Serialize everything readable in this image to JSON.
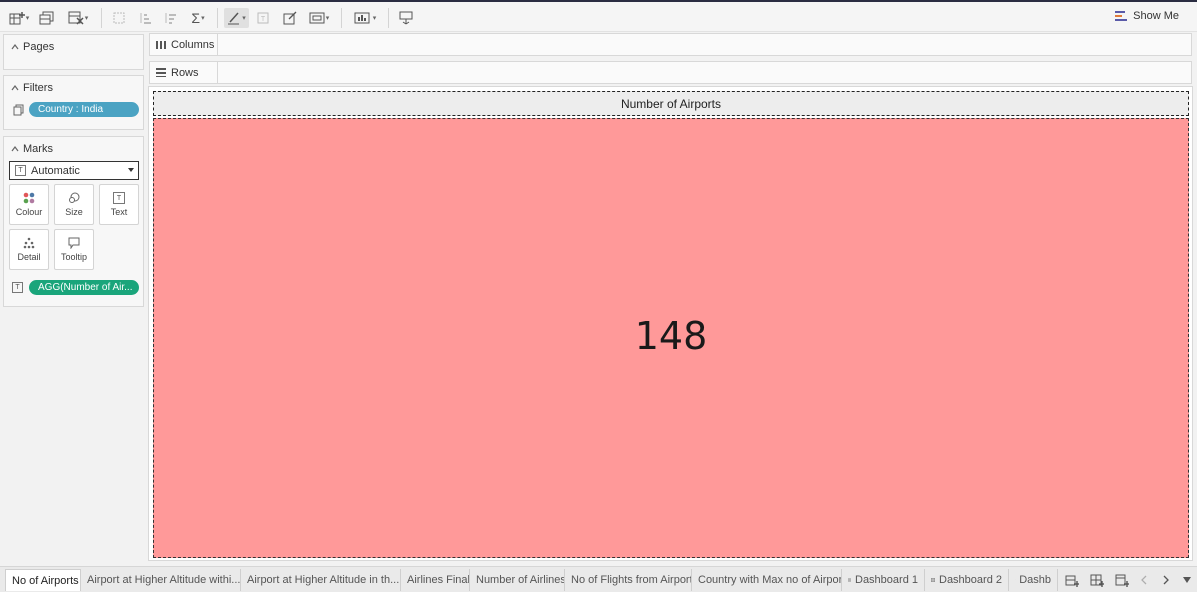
{
  "toolbar": {
    "show_me_label": "Show Me"
  },
  "panels": {
    "pages_label": "Pages",
    "filters_label": "Filters",
    "filter_pill": "Country : India",
    "marks_label": "Marks",
    "mark_type": "Automatic",
    "mark_buttons": {
      "colour": "Colour",
      "size": "Size",
      "text": "Text",
      "detail": "Detail",
      "tooltip": "Tooltip"
    },
    "measure_pill": "AGG(Number of Air..."
  },
  "shelves": {
    "columns_label": "Columns",
    "rows_label": "Rows"
  },
  "view": {
    "title": "Number of Airports",
    "value": "148",
    "fill_color": "#ff9999"
  },
  "tabs": [
    "No of Airports",
    "Airport at Higher Altitude withi...",
    "Airport at Higher Altitude in th...",
    "Airlines Final",
    "Number of Airlines",
    "No of Flights from Airport",
    "Country with Max no of Airport",
    "Dashboard 1",
    "Dashboard 2",
    "Dashb"
  ],
  "colors": {
    "filter_pill": "#4ba3c3",
    "measure_pill": "#1aa57b"
  }
}
